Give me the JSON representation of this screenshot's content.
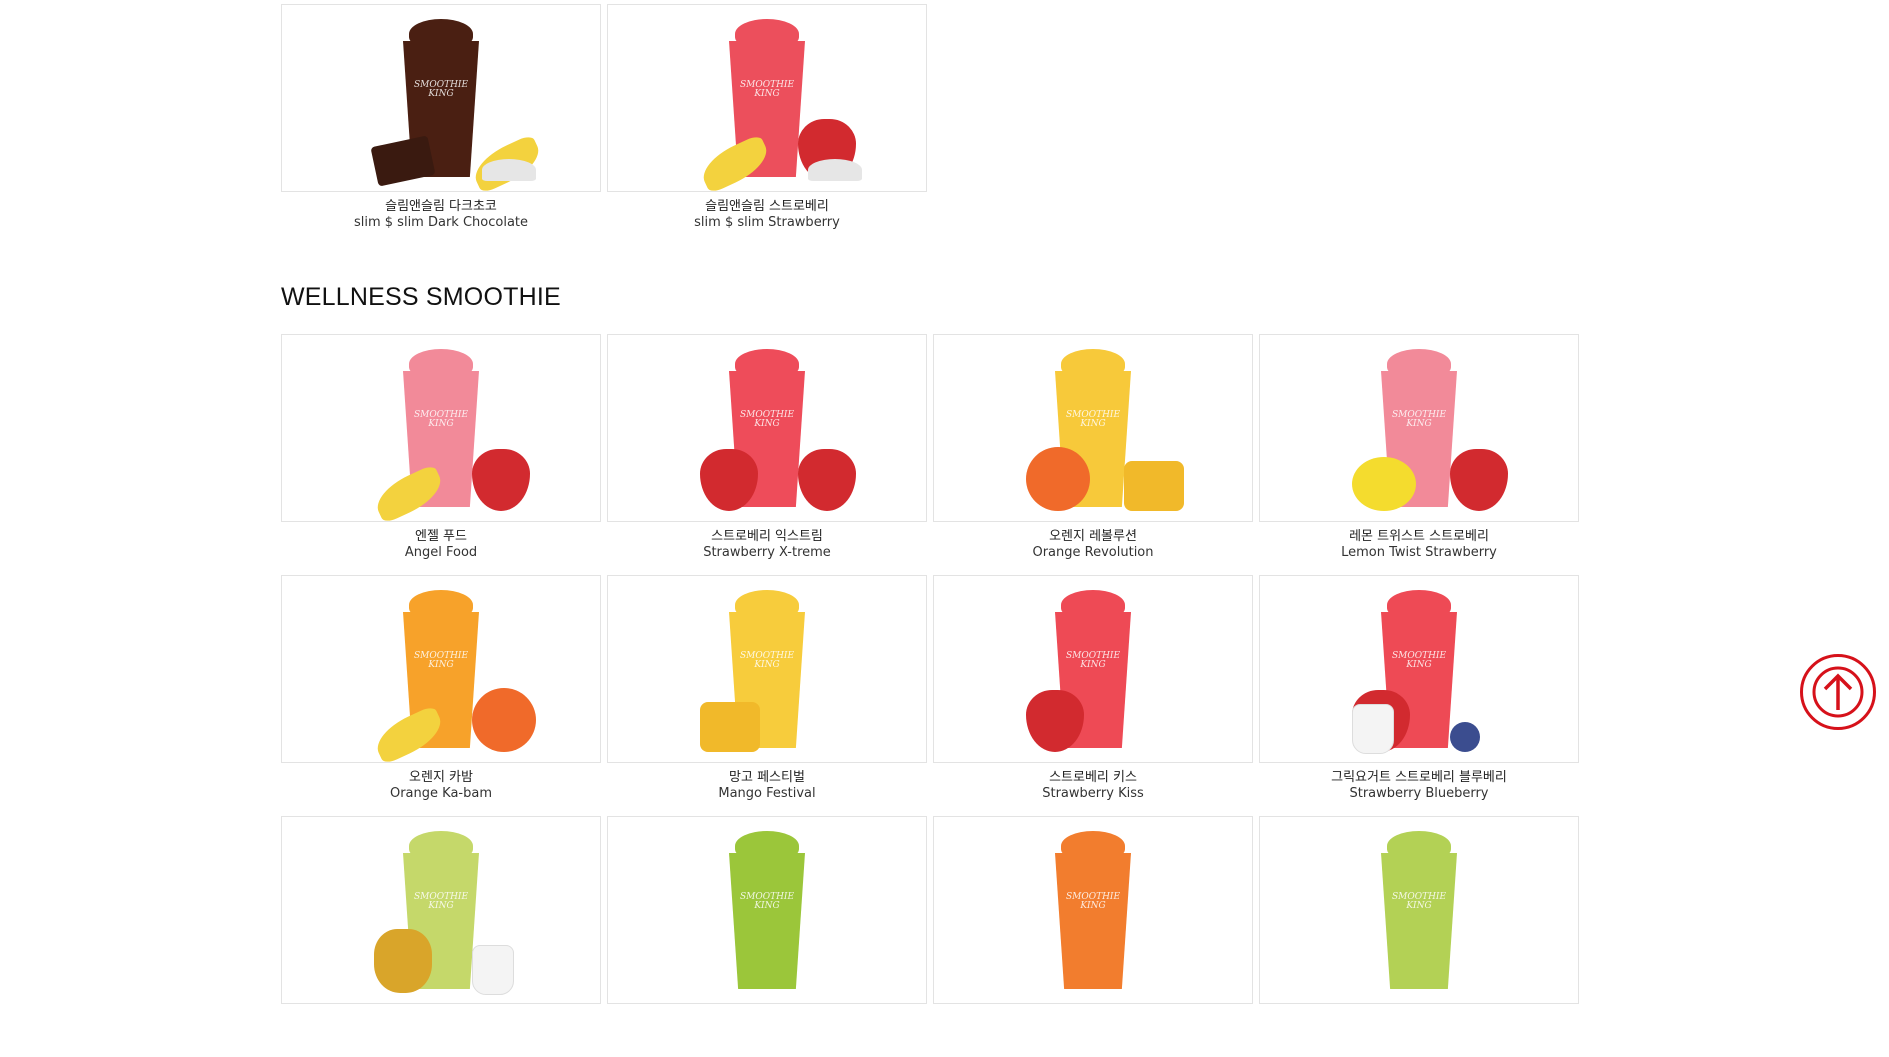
{
  "top_products": [
    {
      "name_ko": "슬림앤슬림 다크초코",
      "name_en": "slim $ slim Dark Chocolate",
      "cup_color": "#4a1f12",
      "fruits": [
        "chocolate",
        "banana",
        "powder"
      ]
    },
    {
      "name_ko": "슬림앤슬림 스트로베리",
      "name_en": "slim $ slim Strawberry",
      "cup_color": "#ec4f5c",
      "fruits": [
        "banana",
        "strawberry",
        "powder"
      ]
    }
  ],
  "wellness": {
    "title": "WELLNESS SMOOTHIE",
    "products": [
      {
        "name_ko": "엔젤 푸드",
        "name_en": "Angel Food",
        "cup_color": "#f28a99",
        "fruits": [
          "banana",
          "strawberry"
        ]
      },
      {
        "name_ko": "스트로베리 익스트림",
        "name_en": "Strawberry X-treme",
        "cup_color": "#ee4c5a",
        "fruits": [
          "strawberry",
          "strawberry"
        ]
      },
      {
        "name_ko": "오렌지 레볼루션",
        "name_en": "Orange Revolution",
        "cup_color": "#f7c93a",
        "fruits": [
          "orange",
          "mango"
        ]
      },
      {
        "name_ko": "레몬 트위스트 스트로베리",
        "name_en": "Lemon Twist Strawberry",
        "cup_color": "#f28a99",
        "fruits": [
          "lemon",
          "strawberry"
        ]
      },
      {
        "name_ko": "오렌지 카밤",
        "name_en": "Orange Ka-bam",
        "cup_color": "#f7a22a",
        "fruits": [
          "banana",
          "orange"
        ]
      },
      {
        "name_ko": "망고 페스티벌",
        "name_en": "Mango Festival",
        "cup_color": "#f7cc3c",
        "fruits": [
          "mango"
        ]
      },
      {
        "name_ko": "스트로베리 키스",
        "name_en": "Strawberry Kiss",
        "cup_color": "#ee4a55",
        "fruits": [
          "strawberry"
        ]
      },
      {
        "name_ko": "그릭요거트 스트로베리 블루베리",
        "name_en": "Strawberry Blueberry",
        "cup_color": "#ee4a55",
        "fruits": [
          "strawberry",
          "blueberry",
          "pitcher"
        ]
      },
      {
        "name_ko": "",
        "name_en": "",
        "cup_color": "#c5d86a",
        "fruits": [
          "pineapple",
          "pitcher"
        ]
      },
      {
        "name_ko": "",
        "name_en": "",
        "cup_color": "#9bc63a",
        "fruits": []
      },
      {
        "name_ko": "",
        "name_en": "",
        "cup_color": "#f27d2e",
        "fruits": []
      },
      {
        "name_ko": "",
        "name_en": "",
        "cup_color": "#b3d155",
        "fruits": []
      }
    ]
  },
  "cup_logo": "SMOOTHIE KING",
  "scroll_top_icon": "arrow-up-circle-icon",
  "accent_color": "#d6111a"
}
